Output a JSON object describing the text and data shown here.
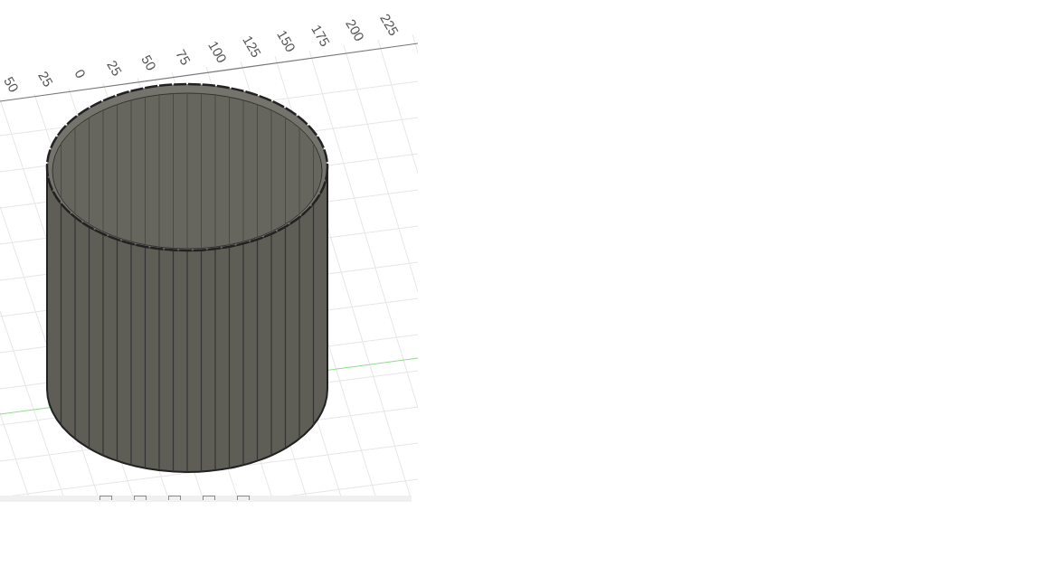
{
  "viewport": {
    "ruler_labels": [
      "50",
      "25",
      "0",
      "25",
      "50",
      "75",
      "100",
      "125",
      "150",
      "175",
      "200",
      "225"
    ]
  }
}
